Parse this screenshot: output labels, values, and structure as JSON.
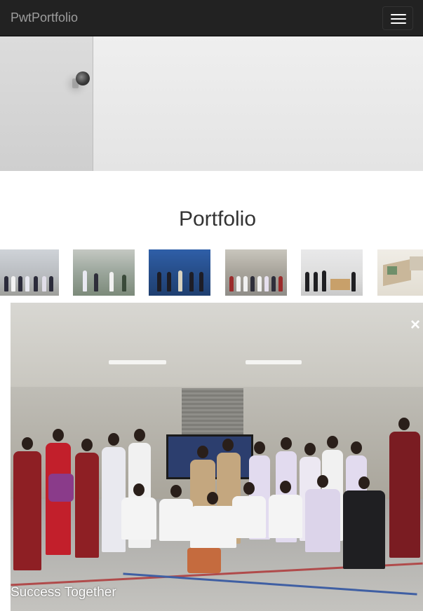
{
  "navbar": {
    "brand": "PwtPortfolio",
    "toggle_icon": "hamburger-menu-icon"
  },
  "portfolio": {
    "title": "Portfolio",
    "thumbnails": [
      {
        "index": 1,
        "description_icon": "photo-thumbnail"
      },
      {
        "index": 2,
        "description_icon": "photo-thumbnail"
      },
      {
        "index": 3,
        "description_icon": "photo-thumbnail"
      },
      {
        "index": 4,
        "description_icon": "photo-thumbnail"
      },
      {
        "index": 5,
        "description_icon": "photo-thumbnail"
      },
      {
        "index": 6,
        "description_icon": "photo-thumbnail"
      }
    ]
  },
  "lightbox": {
    "caption": "Success Together",
    "close_glyph": "×",
    "close_icon": "close-icon"
  },
  "colors": {
    "navbar_bg": "#222222",
    "brand_text": "#9d9d9d",
    "title_text": "#333333",
    "caption_text": "#ffffff"
  }
}
